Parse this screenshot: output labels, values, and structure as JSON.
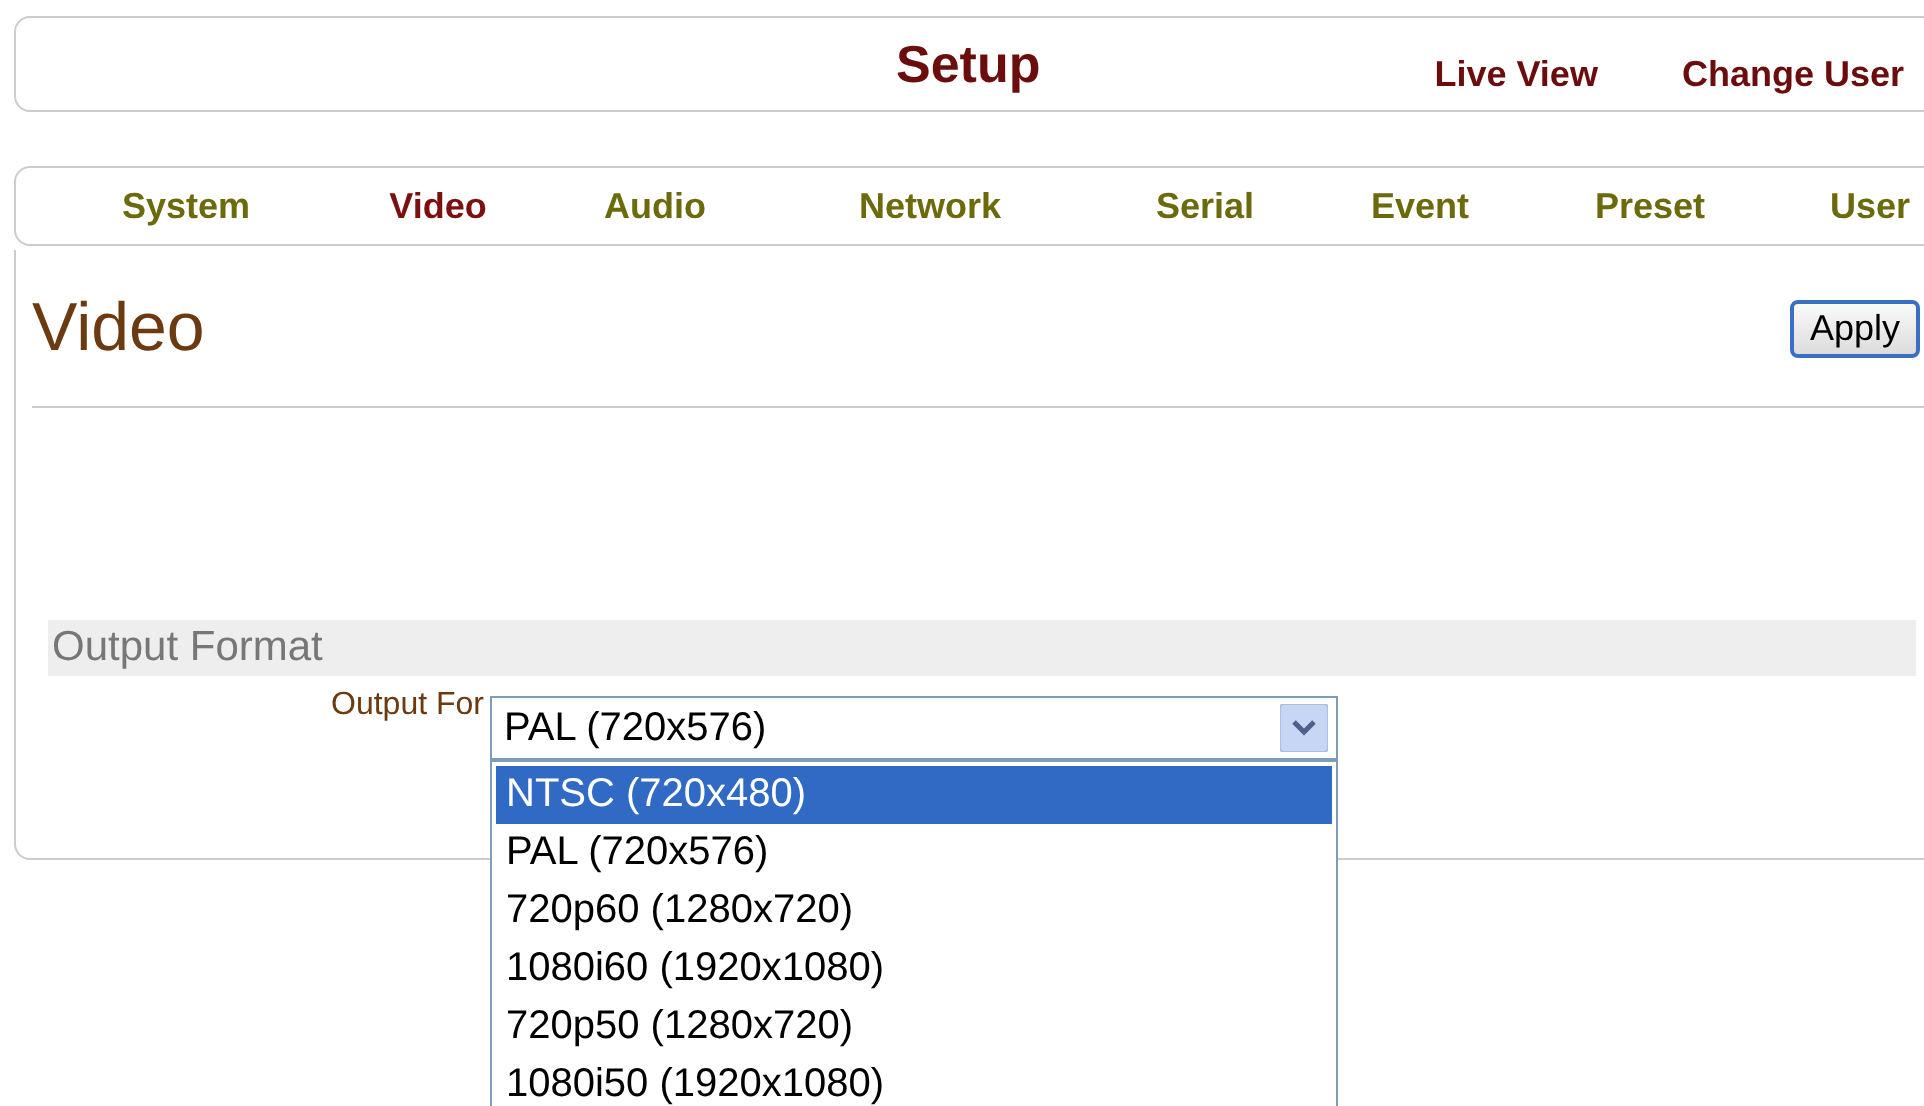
{
  "header": {
    "title": "Setup",
    "links": [
      "Live View",
      "Change User"
    ]
  },
  "tabs": [
    {
      "label": "System",
      "selected": false
    },
    {
      "label": "Video",
      "selected": true
    },
    {
      "label": "Audio",
      "selected": false
    },
    {
      "label": "Network",
      "selected": false
    },
    {
      "label": "Serial",
      "selected": false
    },
    {
      "label": "Event",
      "selected": false
    },
    {
      "label": "Preset",
      "selected": false
    },
    {
      "label": "User",
      "selected": false
    }
  ],
  "page": {
    "title": "Video",
    "apply_button": "Apply"
  },
  "section": {
    "title": "Output Format",
    "field_label": "Output For",
    "value": "PAL (720x576)",
    "options": [
      {
        "label": "NTSC (720x480)",
        "highlighted": true
      },
      {
        "label": "PAL (720x576)",
        "highlighted": false
      },
      {
        "label": "720p60 (1280x720)",
        "highlighted": false
      },
      {
        "label": "1080i60 (1920x1080)",
        "highlighted": false
      },
      {
        "label": "720p50 (1280x720)",
        "highlighted": false
      },
      {
        "label": "1080i50 (1920x1080)",
        "highlighted": false
      }
    ]
  }
}
